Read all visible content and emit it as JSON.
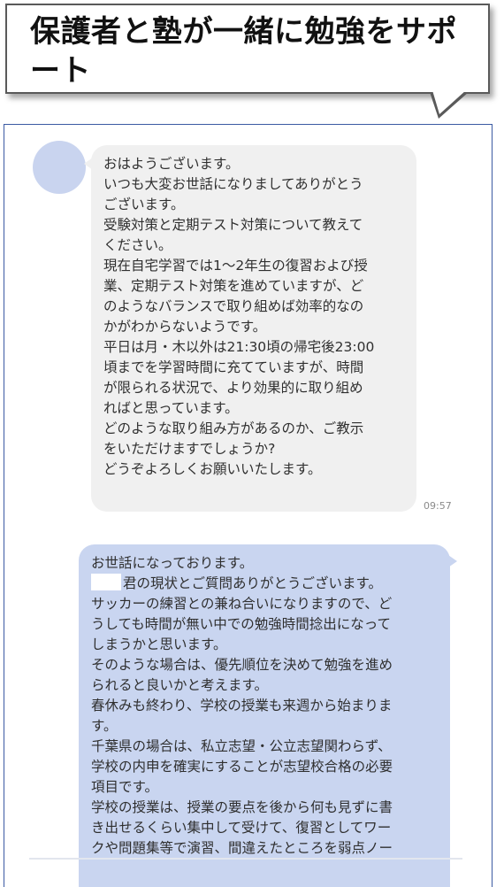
{
  "callout": {
    "title": "保護者と塾が一緒に勉強をサポート"
  },
  "chat": {
    "incoming": {
      "lines": [
        "おはようございます。",
        "いつも大変お世話になりましてありがとう",
        "ございます。",
        "受験対策と定期テスト対策について教えて",
        "ください。",
        "現在自宅学習では1〜2年生の復習および授",
        "業、定期テスト対策を進めていますが、ど",
        "のようなバランスで取り組めば効率的なの",
        "かがわからないようです。",
        "平日は月・木以外は21:30頃の帰宅後23:00",
        "頃までを学習時間に充てていますが、時間",
        "が限られる状況で、より効果的に取り組め",
        "ればと思っています。",
        "どのような取り組み方があるのか、ご教示",
        "をいただけますでしょうか?",
        "どうぞよろしくお願いいたします。"
      ],
      "time": "09:57"
    },
    "outgoing": {
      "lines": [
        "お世話になっております。",
        "君の現状とご質問ありがとうございます。",
        "サッカーの練習との兼ね合いになりますので、ど",
        "うしても時間が無い中での勉強時間捻出になって",
        "しまうかと思います。",
        "そのような場合は、優先順位を決めて勉強を進め",
        "られると良いかと考えます。",
        "春休みも終わり、学校の授業も来週から始まりま",
        "す。",
        "千葉県の場合は、私立志望・公立志望関わらず、",
        "学校の内申を確実にすることが志望校合格の必要",
        "項目です。",
        "学校の授業は、授業の要点を後から何も見ずに書",
        "き出せるくらい集中して受けて、復習としてワー",
        "クや問題集等で演習、間違えたところを弱点ノー"
      ]
    }
  },
  "colors": {
    "incoming_bubble": "#f0f0f0",
    "outgoing_bubble": "#c9d5f0",
    "panel_border": "#3b5aa3",
    "avatar": "#c9d4ef"
  }
}
